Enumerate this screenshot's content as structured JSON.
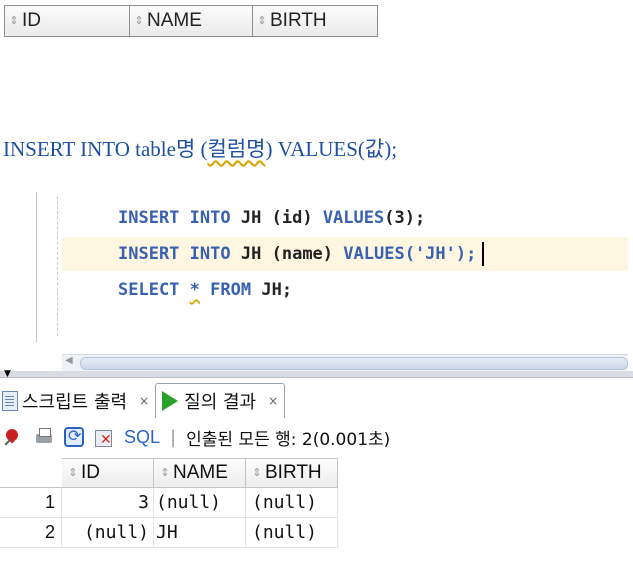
{
  "top_header": {
    "columns": [
      "ID",
      "NAME",
      "BIRTH"
    ]
  },
  "syntax_line": {
    "prefix": "INSERT INTO table",
    "suffix_korean": "명 (",
    "underlined": "컬럼명",
    "rest": ") VALUES(",
    "value_word": "값",
    "end": ");"
  },
  "editor": {
    "lines": [
      {
        "kw1": "INSERT",
        "kw2": "INTO",
        "table": "JH",
        "args": "(id)",
        "kw3": "VALUES",
        "val": "(3);"
      },
      {
        "kw1": "INSERT",
        "kw2": "INTO",
        "table": "JH",
        "args": "(name)",
        "kw3": "VALUES",
        "val": "('JH');"
      },
      {
        "kw1": "SELECT",
        "star": "*",
        "kw2": "FROM",
        "table": "JH;"
      }
    ]
  },
  "tabs": [
    {
      "label": "스크립트 출력",
      "close": "×",
      "active": false
    },
    {
      "label": "질의 결과",
      "close": "×",
      "active": true
    }
  ],
  "toolbar": {
    "sql_label": "SQL",
    "separator": "|",
    "status": "인출된 모든 행: 2(0.001초)"
  },
  "result_grid": {
    "columns": [
      "ID",
      "NAME",
      "BIRTH"
    ],
    "rows": [
      {
        "num": "1",
        "id": "3",
        "name": "(null)",
        "birth": "(null)"
      },
      {
        "num": "2",
        "id": "(null)",
        "name": "JH",
        "birth": "(null)"
      }
    ]
  },
  "colors": {
    "keyword": "#3a60b0",
    "syntax_text": "#1f4fa0",
    "current_line": "#fdf6e0",
    "run_icon": "#2ba12b"
  }
}
